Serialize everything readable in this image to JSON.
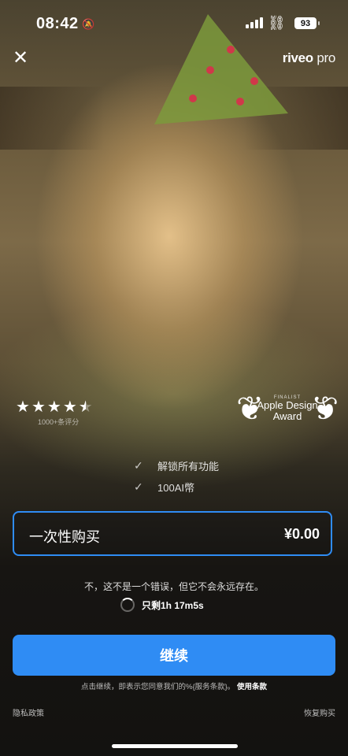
{
  "status_bar": {
    "time": "08:42",
    "battery": "93"
  },
  "brand": {
    "name": "riveo",
    "tier": "pro"
  },
  "rating": {
    "stars": 4.5,
    "count_label": "1000+条评分"
  },
  "award": {
    "finalist": "FINALIST",
    "line1": "Apple Design",
    "line2": "Award"
  },
  "features": [
    {
      "label": "解锁所有功能"
    },
    {
      "label": "100AI幣"
    }
  ],
  "plan": {
    "name": "一次性购买",
    "price": "¥0.00"
  },
  "notice": "不，这不是一个错误，但它不会永远存在。",
  "countdown": "只剩1h 17m5s",
  "continue_label": "继续",
  "terms": {
    "prefix": "点击继续，即表示您同意我们的%{服务条款}。",
    "link": "使用条款"
  },
  "footer": {
    "privacy": "隐私政策",
    "restore": "恢复购买"
  },
  "colors": {
    "accent": "#2f8cf4"
  }
}
